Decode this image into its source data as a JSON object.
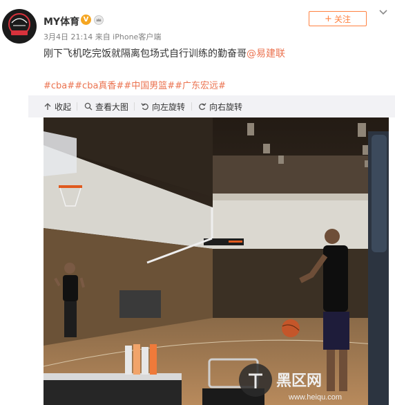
{
  "account": {
    "name": "MY体育",
    "avatar_text": "MY SPORTS STUDIO",
    "avatar_sub": "MY体育",
    "verified_icon": "verified-v-badge",
    "vip_icon": "crown-icon"
  },
  "post": {
    "meta": "3月4日 21:14 来自 iPhone客户端",
    "text_before": "刚下飞机吃完饭就隔离包场式自行训练的勤奋哥",
    "mention": "@易建联",
    "hashtags": "#cba##cba真香##中国男篮##广东宏远#"
  },
  "follow_button": {
    "label": "关注",
    "icon": "plus-icon"
  },
  "toolbar": {
    "collapse": "收起",
    "view_large": "查看大图",
    "rotate_left": "向左旋转",
    "rotate_right": "向右旋转"
  },
  "watermark": {
    "brand": "黑区网",
    "url": "www.heiqu.com"
  },
  "colors": {
    "accent": "#eb7350",
    "follow": "#ff8140",
    "badge": "#f5a623",
    "toolbar_bg": "#f2f2f5"
  }
}
